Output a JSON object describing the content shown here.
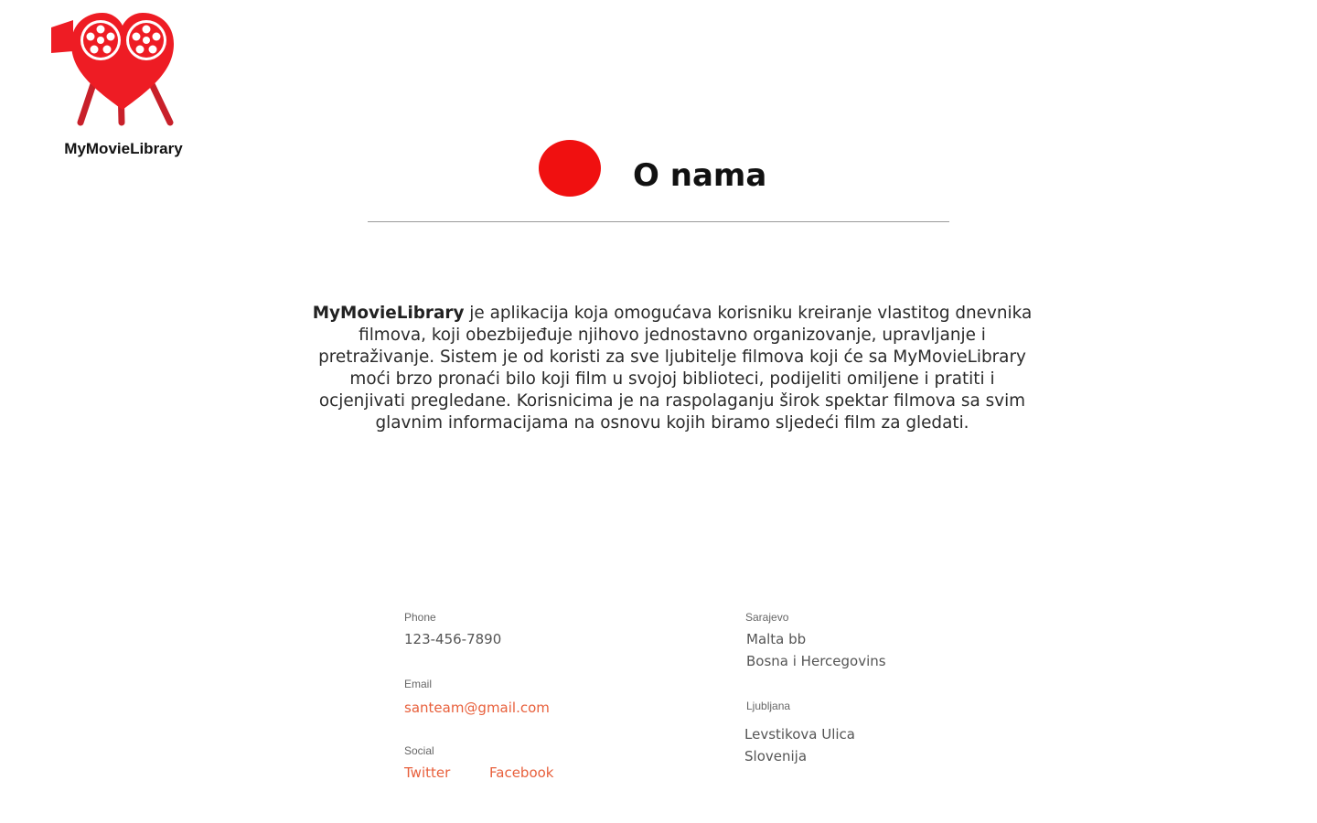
{
  "brand": {
    "name": "MyMovieLibrary",
    "logo_icon": "heart-film-camera-logo",
    "accent_color": "#f01010"
  },
  "heading": {
    "title": "O nama"
  },
  "about": {
    "brand_bold": "MyMovieLibrary",
    "text": " je aplikacija koja omogućava korisniku kreiranje vlastitog dnevnika filmova, koji obezbijeđuje njihovo jednostavno organizovanje, upravljanje i pretraživanje. Sistem je od koristi za sve ljubitelje filmova koji će sa MyMovieLibrary moći brzo pronaći bilo koji film u svojoj biblioteci, podijeliti omiljene i pratiti i ocjenjivati pregledane. Korisnicima je na raspolaganju širok spektar filmova sa svim glavnim informacijama na osnovu kojih biramo sljedeći film za gledati."
  },
  "contact": {
    "phone": {
      "label": "Phone",
      "value": "123-456-7890"
    },
    "email": {
      "label": "Email",
      "value": "santeam@gmail.com"
    },
    "social": {
      "label": "Social",
      "twitter": "Twitter",
      "facebook": "Facebook"
    },
    "sarajevo": {
      "label": "Sarajevo",
      "line1": "Malta bb",
      "line2": "Bosna i Hercegovins"
    },
    "ljubljana": {
      "label": "Ljubljana",
      "line1": "Levstikova Ulica",
      "line2": "Slovenija"
    },
    "link_color": "#e8603c"
  }
}
